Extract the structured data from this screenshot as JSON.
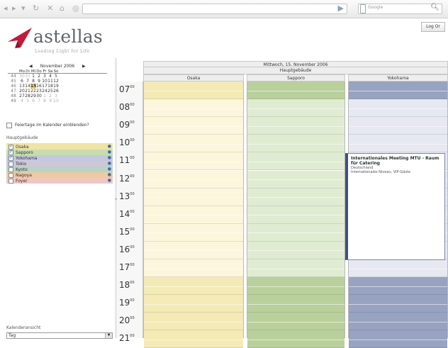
{
  "browser": {
    "search_placeholder": "Google"
  },
  "app": {
    "logo_name": "astellas",
    "logo_tagline": "Leading Light for Life",
    "logout_label": "Log Or"
  },
  "minical": {
    "month_label": "November 2006",
    "day_names": [
      "Mo",
      "Di",
      "Mi",
      "Do",
      "Fr",
      "Sa",
      "So"
    ],
    "weeks": [
      {
        "wk": "44",
        "days": [
          "30",
          "31",
          "1",
          "2",
          "3",
          "4",
          "5"
        ]
      },
      {
        "wk": "45",
        "days": [
          "6",
          "7",
          "8",
          "9",
          "10",
          "11",
          "12"
        ]
      },
      {
        "wk": "46",
        "days": [
          "13",
          "14",
          "15",
          "16",
          "17",
          "18",
          "19"
        ]
      },
      {
        "wk": "47",
        "days": [
          "20",
          "21",
          "22",
          "23",
          "24",
          "25",
          "26"
        ]
      },
      {
        "wk": "48",
        "days": [
          "27",
          "28",
          "29",
          "30",
          "1",
          "2",
          "3"
        ]
      },
      {
        "wk": "49",
        "days": [
          "4",
          "5",
          "6",
          "7",
          "8",
          "9",
          "10"
        ]
      }
    ],
    "today": "15"
  },
  "holidays_label": "Feiertage im Kalender einblenden?",
  "buildings_title": "Hauptgebäude",
  "buildings": [
    {
      "name": "Osaka",
      "checked": true,
      "color": "#efe3a6"
    },
    {
      "name": "Sapporo",
      "checked": true,
      "color": "#c6ddb0"
    },
    {
      "name": "Yokohama",
      "checked": true,
      "color": "#c4c8dc"
    },
    {
      "name": "Tokio",
      "checked": false,
      "color": "#cfc6da"
    },
    {
      "name": "Kyoto",
      "checked": false,
      "color": "#b9d4c4"
    },
    {
      "name": "Nagoya",
      "checked": false,
      "color": "#efc9a2"
    },
    {
      "name": "Foyer",
      "checked": false,
      "color": "#f0c6c2"
    }
  ],
  "calendar_view": {
    "label": "Kalenderansicht",
    "value": "Tag"
  },
  "day_header": "Mittwoch, 15. November 2006",
  "building_header": "Hauptgebäude",
  "rooms": [
    "Osaka",
    "Sapporo",
    "Yokohama"
  ],
  "hours": [
    "07",
    "08",
    "09",
    "10",
    "11",
    "12",
    "13",
    "14",
    "15",
    "16",
    "17",
    "18",
    "19",
    "20",
    "21"
  ],
  "event": {
    "title": "Internationales Meeting MTU - Raum für Catering",
    "line1": "Deutschland",
    "line2": "Internationales Niveau, VIP-Gäste"
  },
  "colors": {
    "osaka_light": "#fcf6dc",
    "osaka_dark": "#f4eab6",
    "sapporo_light": "#e0ecd2",
    "sapporo_dark": "#b9d09c",
    "yoko_light": "#e6e9f1",
    "yoko_dark": "#97a3c0"
  }
}
